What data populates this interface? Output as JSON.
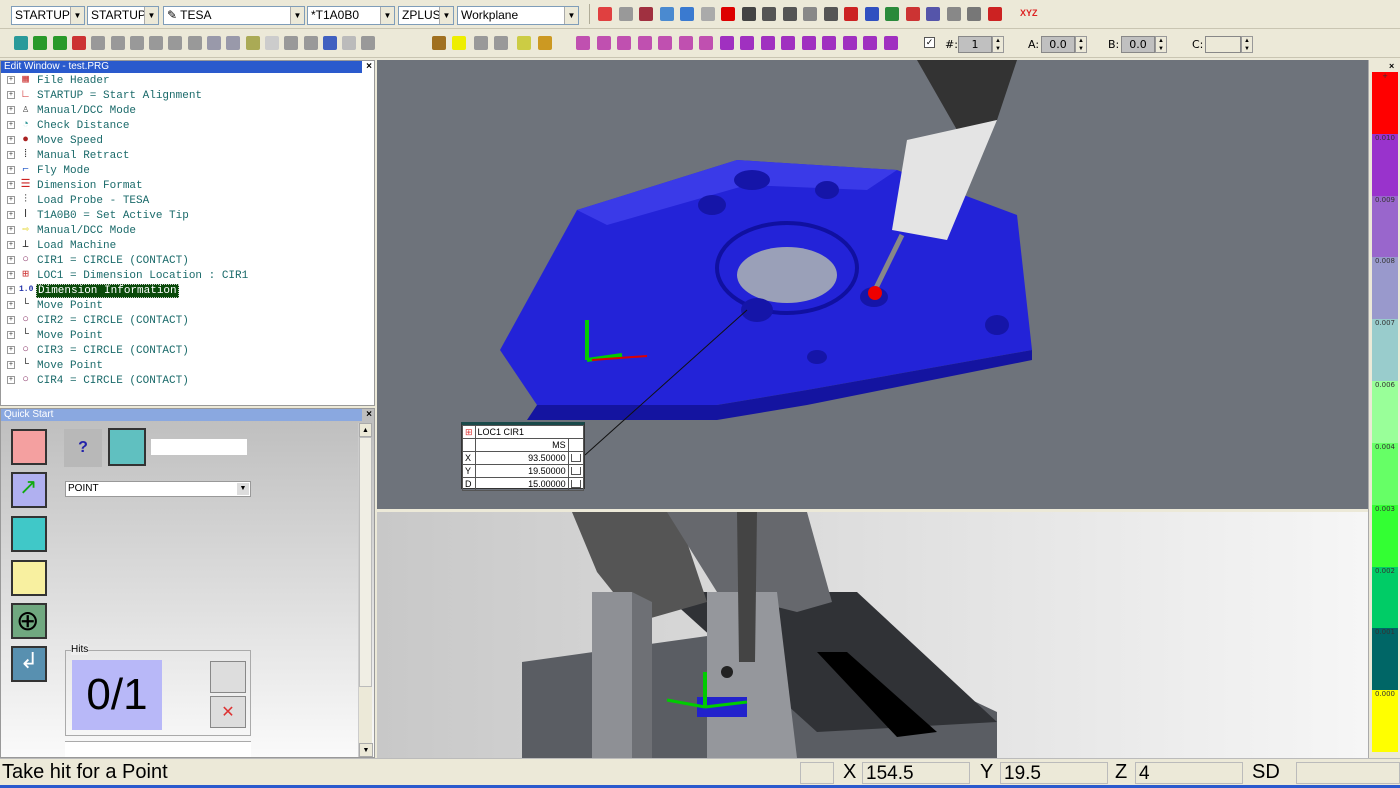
{
  "toolbar": {
    "alignment": "STARTUP",
    "alignment2": "STARTUP",
    "probe": "TESA",
    "tip": "*T1A0B0",
    "workplane_dir": "ZPLUS",
    "view": "Workplane",
    "xyz_label": "XYZ",
    "rotary": {
      "count_label": "#:",
      "count": "1",
      "a_label": "A:",
      "a": "0.0",
      "b_label": "B:",
      "b": "0.0",
      "c_label": "C:",
      "c": ""
    }
  },
  "edit_window": {
    "title": "Edit Window - test.PRG",
    "items": [
      {
        "label": "File Header",
        "icon": "file-header-icon",
        "color": "#cc3333",
        "glyph": "▦"
      },
      {
        "label": "STARTUP = Start Alignment",
        "icon": "alignment-icon",
        "color": "#cc2222",
        "glyph": "∟"
      },
      {
        "label": "Manual/DCC Mode",
        "icon": "probe-mode-icon",
        "color": "#444",
        "glyph": "♙"
      },
      {
        "label": "Check Distance",
        "icon": "check-distance-icon",
        "color": "#339999",
        "glyph": "◔"
      },
      {
        "label": "Move Speed",
        "icon": "move-speed-icon",
        "color": "#aa2222",
        "glyph": "●"
      },
      {
        "label": "Manual Retract",
        "icon": "retract-icon",
        "color": "#333",
        "glyph": "⁞"
      },
      {
        "label": "Fly Mode",
        "icon": "fly-mode-icon",
        "color": "#3366cc",
        "glyph": "⌐"
      },
      {
        "label": "Dimension Format",
        "icon": "dimension-format-icon",
        "color": "#cc2222",
        "glyph": "☰"
      },
      {
        "label": "Load Probe - TESA",
        "icon": "load-probe-icon",
        "color": "#333",
        "glyph": "⫶"
      },
      {
        "label": "T1A0B0 = Set Active Tip",
        "icon": "active-tip-icon",
        "color": "#333",
        "glyph": "ǀ"
      },
      {
        "label": "Manual/DCC Mode",
        "icon": "arrow-right-icon",
        "color": "#ddcc00",
        "glyph": "⇨"
      },
      {
        "label": "Load Machine",
        "icon": "load-machine-icon",
        "color": "#333",
        "glyph": "⊥"
      },
      {
        "label": "CIR1 = CIRCLE (CONTACT)",
        "icon": "circle-icon",
        "color": "#883366",
        "glyph": "○"
      },
      {
        "label": "LOC1 = Dimension Location : CIR1",
        "icon": "location-icon",
        "color": "#cc3333",
        "glyph": "⊞"
      },
      {
        "label": "Dimension Information",
        "icon": "dimension-info-icon",
        "color": "#2233aa",
        "glyph": "1.0",
        "selected": true
      },
      {
        "label": "Move Point",
        "icon": "move-point-icon",
        "color": "#333",
        "glyph": "└"
      },
      {
        "label": "CIR2 = CIRCLE (CONTACT)",
        "icon": "circle-icon",
        "color": "#883366",
        "glyph": "○"
      },
      {
        "label": "Move Point",
        "icon": "move-point-icon",
        "color": "#333",
        "glyph": "└"
      },
      {
        "label": "CIR3 = CIRCLE (CONTACT)",
        "icon": "circle-icon",
        "color": "#883366",
        "glyph": "○"
      },
      {
        "label": "Move Point",
        "icon": "move-point-icon",
        "color": "#333",
        "glyph": "└"
      },
      {
        "label": "CIR4 = CIRCLE (CONTACT)",
        "icon": "circle-icon",
        "color": "#883366",
        "glyph": "○"
      }
    ]
  },
  "quick_start": {
    "title": "Quick Start",
    "help": "?",
    "name_value": "",
    "feature_type": "POINT",
    "hits_label": "Hits",
    "hits": "0/1"
  },
  "dimension_box": {
    "title": "LOC1 CIR1",
    "column": "MS",
    "rows": [
      {
        "axis": "X",
        "value": "93.50000"
      },
      {
        "axis": "Y",
        "value": "19.50000"
      },
      {
        "axis": "D",
        "value": "15.00000"
      }
    ]
  },
  "color_scale": {
    "segments": [
      {
        "label": "+",
        "color": "#ff0000"
      },
      {
        "label": "0.010",
        "color": "#9933cc"
      },
      {
        "label": "0.009",
        "color": "#9966cc"
      },
      {
        "label": "0.008",
        "color": "#9999cc"
      },
      {
        "label": "0.007",
        "color": "#99cccc"
      },
      {
        "label": "0.006",
        "color": "#99ff99"
      },
      {
        "label": "0.004",
        "color": "#66ff66"
      },
      {
        "label": "0.003",
        "color": "#33ff33"
      },
      {
        "label": "0.002",
        "color": "#00cc66"
      },
      {
        "label": "0.001",
        "color": "#006666"
      },
      {
        "label": "0.000",
        "color": "#ffff00"
      }
    ]
  },
  "status_bar": {
    "message": "Take hit for a Point",
    "x_label": "X",
    "x": "154.5",
    "y_label": "Y",
    "y": "19.5",
    "z_label": "Z",
    "z": "4",
    "mode": "SD"
  },
  "colors": {
    "part": "#2222dd",
    "viewport_top": "#6e737b",
    "selection": "#0a4a0a"
  }
}
